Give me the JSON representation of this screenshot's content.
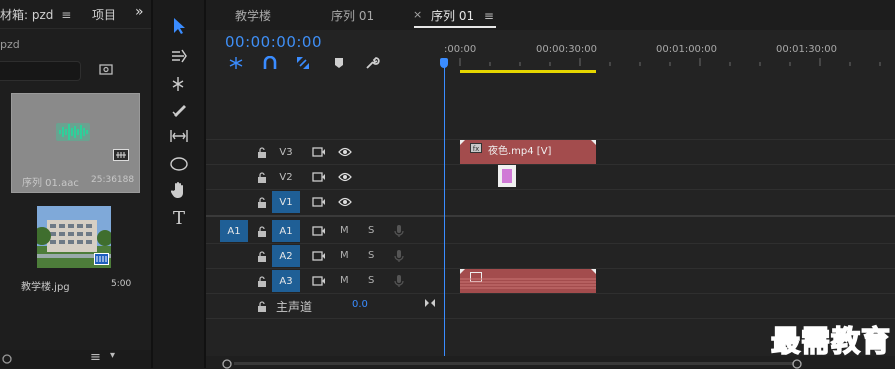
{
  "project_panel": {
    "tabs": [
      {
        "label": "材箱: pzd"
      },
      {
        "label": "项目"
      }
    ],
    "more_glyph": "»",
    "subtitle": "pzd",
    "items": [
      {
        "name": "序列 01.aac",
        "duration": "25:36188"
      },
      {
        "name": "教学楼.jpg",
        "duration": "5:00"
      }
    ]
  },
  "timeline": {
    "tabs": [
      {
        "label": "教学楼"
      },
      {
        "label": "序列 01"
      },
      {
        "label": "序列 01",
        "active": true
      }
    ],
    "close_glyph": "×",
    "timecode": "00:00:00:00",
    "ruler_labels": [
      ":00:00",
      "00:00:30:00",
      "00:01:00:00",
      "00:01:30:00"
    ],
    "video_tracks": [
      {
        "name": "V3",
        "targeted": false
      },
      {
        "name": "V2",
        "targeted": false
      },
      {
        "name": "V1",
        "targeted": true
      }
    ],
    "audio_tracks": [
      {
        "name": "A1",
        "source": "A1",
        "targeted": true,
        "mute": "M",
        "solo": "S"
      },
      {
        "name": "A2",
        "targeted": true,
        "mute": "M",
        "solo": "S"
      },
      {
        "name": "A3",
        "targeted": true,
        "mute": "M",
        "solo": "S"
      }
    ],
    "master": {
      "label": "主声道",
      "value": "0.0"
    },
    "clips": [
      {
        "track": "V3",
        "label": "夜色.mp4 [V]",
        "badge": "fx"
      },
      {
        "track": "A3",
        "label": "",
        "badge": "fx"
      }
    ]
  },
  "watermark": "最需教育",
  "colors": {
    "accent": "#3a8cff",
    "clip": "#a34c4d",
    "audio_icon": "#2fcf9a"
  }
}
